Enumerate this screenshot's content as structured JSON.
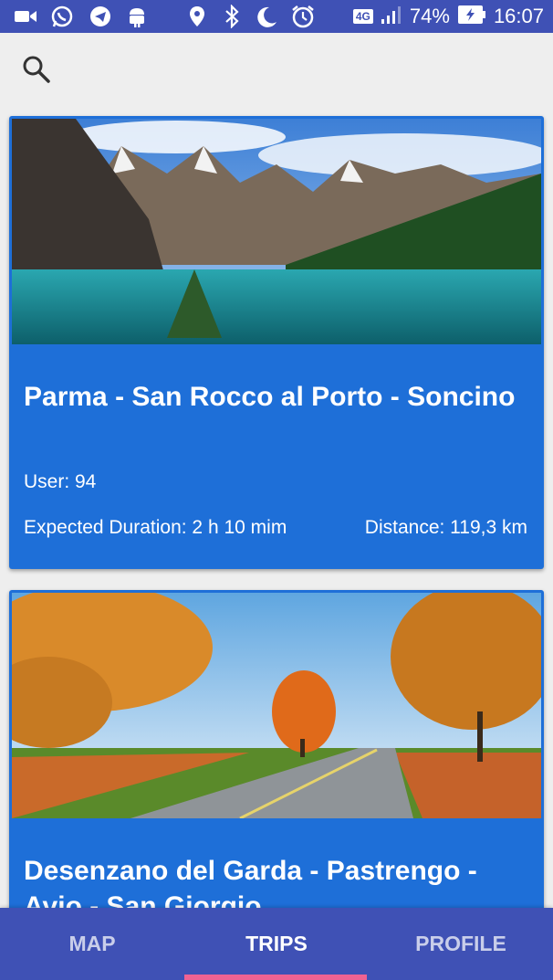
{
  "status_bar": {
    "battery": "74%",
    "time": "16:07",
    "network": "4G",
    "icons": [
      "video-icon",
      "whatsapp-icon",
      "telegram-icon",
      "android-icon",
      "location-icon",
      "bluetooth-icon",
      "moon-icon",
      "alarm-icon",
      "network-4g-icon",
      "signal-icon",
      "battery-icon"
    ]
  },
  "search": {
    "icon": "search-icon"
  },
  "trips": [
    {
      "title": "Parma - San Rocco al Porto - Soncino",
      "user": "User: 94",
      "duration": "Expected Duration: 2 h 10 mim",
      "distance": "Distance: 119,3 km",
      "image": "mountain-lake-photo"
    },
    {
      "title": "Desenzano del Garda - Pastrengo - Avio - San Giorgio",
      "image": "autumn-road-photo"
    }
  ],
  "nav": {
    "map": "MAP",
    "trips": "TRIPS",
    "profile": "PROFILE",
    "active": "TRIPS"
  },
  "colors": {
    "primary": "#3f51b5",
    "card": "#1e6fd8",
    "accent": "#f06292",
    "background": "#eeeeee"
  }
}
